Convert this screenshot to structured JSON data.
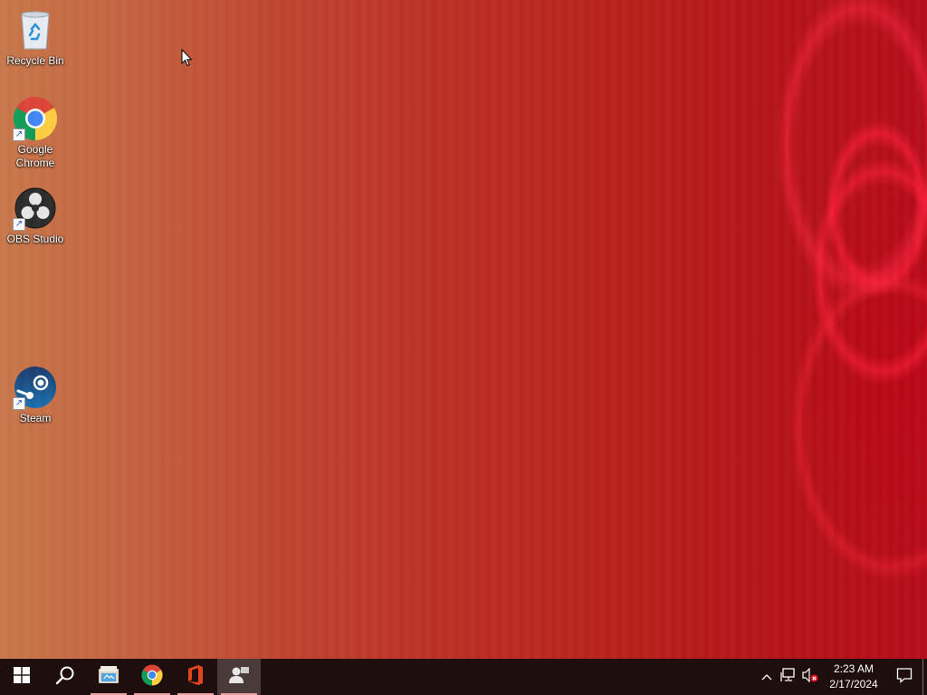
{
  "desktop": {
    "icons": [
      {
        "label": "Recycle Bin",
        "icon": "recycle-bin-icon"
      },
      {
        "label": "Google Chrome",
        "icon": "chrome-icon",
        "shortcut": true
      },
      {
        "label": "OBS Studio",
        "icon": "obs-icon",
        "shortcut": true
      },
      {
        "label": "Steam",
        "icon": "steam-icon",
        "shortcut": true
      }
    ]
  },
  "taskbar": {
    "buttons": [
      {
        "name": "start",
        "icon": "windows-start-icon"
      },
      {
        "name": "search",
        "icon": "search-icon"
      },
      {
        "name": "file-explorer",
        "icon": "file-explorer-icon",
        "running": true
      },
      {
        "name": "chrome",
        "icon": "chrome-icon",
        "running": true
      },
      {
        "name": "office",
        "icon": "office-icon",
        "running": true
      },
      {
        "name": "people-app",
        "icon": "people-icon",
        "running": true,
        "active": true
      }
    ],
    "tray": {
      "time": "2:23 AM",
      "date": "2/17/2024",
      "icons": [
        "chevron-up-icon",
        "network-icon",
        "volume-muted-icon",
        "notification-icon"
      ]
    }
  },
  "colors": {
    "taskbar_bg": "#1e0e0e",
    "running_indicator": "#e8a0a0",
    "accent_red": "#b8211c"
  }
}
